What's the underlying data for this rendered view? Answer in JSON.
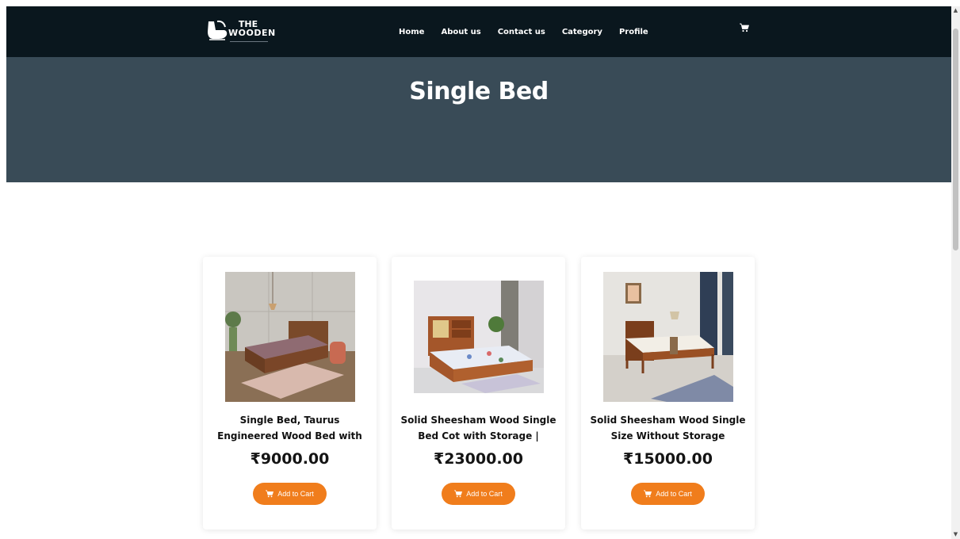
{
  "header": {
    "logo": {
      "line1": "THE",
      "line2": "WOODEN"
    },
    "nav": [
      "Home",
      "About us",
      "Contact us",
      "Category",
      "Profile"
    ]
  },
  "hero": {
    "title": "Single Bed"
  },
  "products": [
    {
      "title": "Single Bed, Taurus Engineered Wood Bed with Storage, (Brown Finish)",
      "title_display": "Single Bed, Taurus Engineered Wood Bed with Storage,...",
      "price": "₹9000.00",
      "button": "Add to Cart"
    },
    {
      "title": "Solid Sheesham Wood Single Bed Cot with Storage | Single...",
      "title_display": "Solid Sheesham Wood Single Bed Cot with Storage | Single...",
      "price": "₹23000.00",
      "button": "Add to Cart"
    },
    {
      "title": "Solid Sheesham Wood Single Size Without Storage Palang...",
      "title_display": "Solid Sheesham Wood Single Size Without Storage Palang...",
      "price": "₹15000.00",
      "button": "Add to Cart"
    }
  ],
  "colors": {
    "navbar": "#0a171e",
    "hero": "#394b57",
    "accent": "#f07d1c"
  },
  "icons": {
    "logo": "chair-logo-icon",
    "cart": "shopping-cart-icon"
  }
}
